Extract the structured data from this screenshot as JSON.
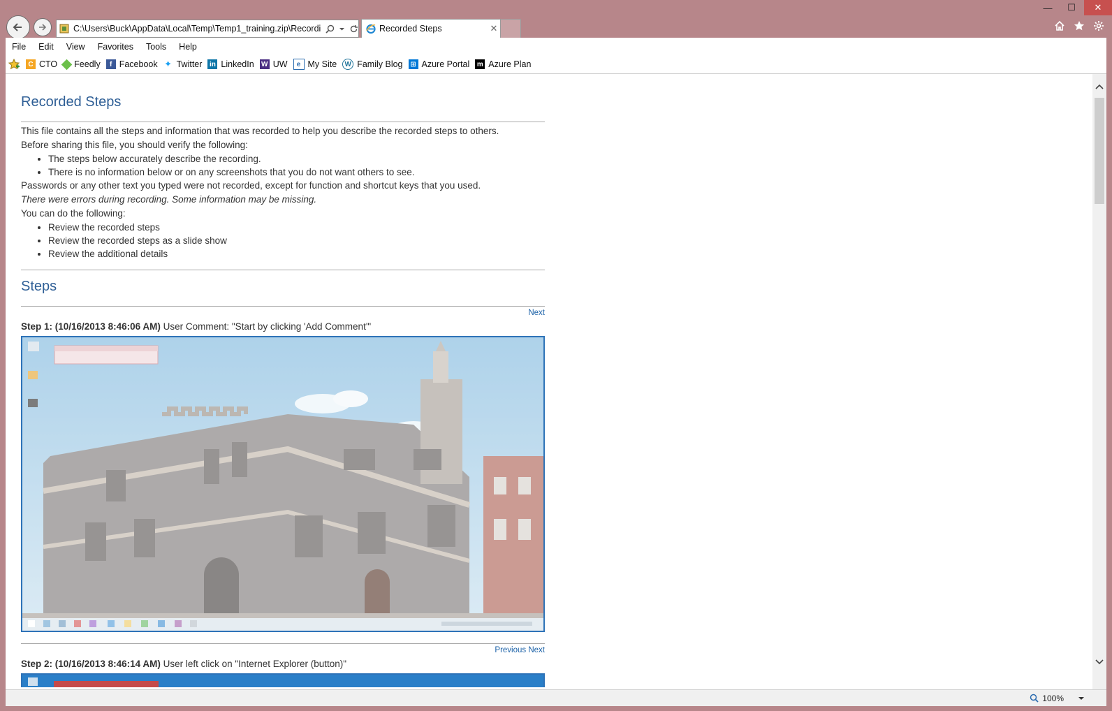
{
  "window": {
    "address_url": "C:\\Users\\Buck\\AppData\\Local\\Temp\\Temp1_training.zip\\Recordin",
    "tab_title": "Recorded Steps",
    "minimize": "—",
    "maximize": "☐",
    "close": "✕"
  },
  "menu": [
    "File",
    "Edit",
    "View",
    "Favorites",
    "Tools",
    "Help"
  ],
  "favorites": [
    {
      "label": "CTO",
      "color": "#f5a623"
    },
    {
      "label": "Feedly",
      "color": "#6cc04a"
    },
    {
      "label": "Facebook",
      "color": "#3b5998"
    },
    {
      "label": "Twitter",
      "color": "#1da1f2"
    },
    {
      "label": "LinkedIn",
      "color": "#0e76a8"
    },
    {
      "label": "UW",
      "color": "#4b2e83"
    },
    {
      "label": "My Site",
      "color": "#2b6cb0"
    },
    {
      "label": "Family Blog",
      "color": "#21759b"
    },
    {
      "label": "Azure Portal",
      "color": "#0078d7"
    },
    {
      "label": "Azure Plan",
      "color": "#000000"
    }
  ],
  "page": {
    "title": "Recorded Steps",
    "intro": "This file contains all the steps and information that was recorded to help you describe the recorded steps to others.",
    "verify": "Before sharing this file, you should verify the following:",
    "verify_items": [
      "The steps below accurately describe the recording.",
      "There is no information below or on any screenshots that you do not want others to see."
    ],
    "passwords_note": "Passwords or any other text you typed were not recorded, except for function and shortcut keys that you used.",
    "errors_note": "There were errors during recording. Some information may be missing.",
    "you_can": "You can do the following:",
    "links": [
      "Review the recorded steps",
      "Review the recorded steps as a slide show",
      "Review the additional details"
    ],
    "steps_title": "Steps",
    "steps": [
      {
        "nav": "Next",
        "header": "Step 1: (10/16/2013 8:46:06 AM)",
        "text": "User Comment: \"Start by clicking 'Add Comment'\""
      },
      {
        "nav": "Previous Next",
        "header": "Step 2: (10/16/2013 8:46:14 AM)",
        "text": "User left click on \"Internet Explorer (button)\""
      }
    ]
  },
  "status": {
    "zoom": "100%"
  }
}
